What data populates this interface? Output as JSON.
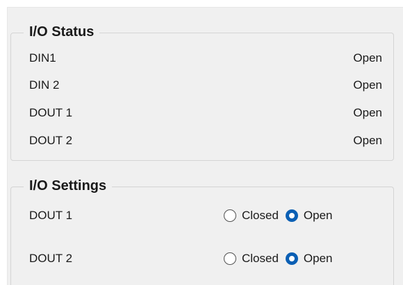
{
  "io_status": {
    "title": "I/O Status",
    "rows": [
      {
        "label": "DIN1",
        "value": "Open"
      },
      {
        "label": "DIN 2",
        "value": "Open"
      },
      {
        "label": "DOUT 1",
        "value": "Open"
      },
      {
        "label": "DOUT 2",
        "value": "Open"
      }
    ]
  },
  "io_settings": {
    "title": "I/O Settings",
    "rows": [
      {
        "label": "DOUT 1",
        "closed_label": "Closed",
        "open_label": "Open",
        "selected": "Open"
      },
      {
        "label": "DOUT 2",
        "closed_label": "Closed",
        "open_label": "Open",
        "selected": "Open"
      }
    ]
  },
  "colors": {
    "panel_background": "#f0f0f0",
    "radio_selected": "#0a5fb4",
    "group_border": "#d4d4d4"
  }
}
